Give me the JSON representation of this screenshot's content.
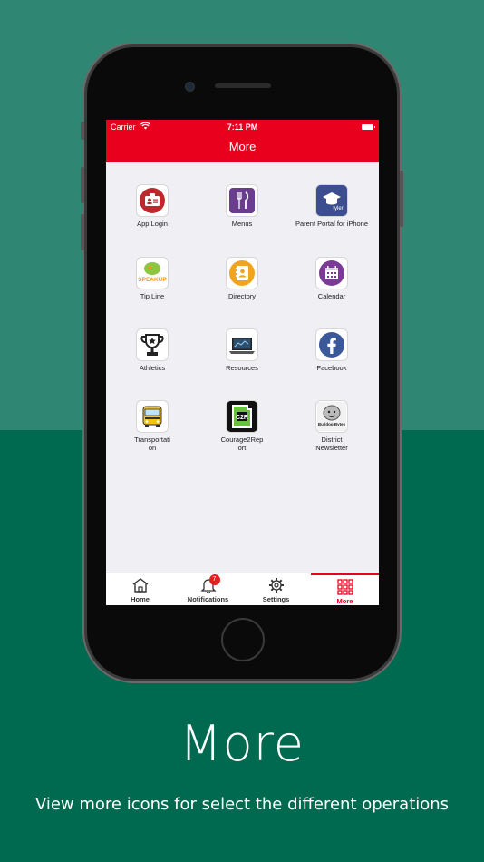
{
  "status_bar": {
    "carrier": "Carrier",
    "time": "7:11 PM"
  },
  "header": {
    "title": "More"
  },
  "tiles": [
    {
      "label": "App Login",
      "icon": "id-card-icon"
    },
    {
      "label": "Menus",
      "icon": "fork-knife-icon"
    },
    {
      "label": "Parent Portal for iPhone",
      "icon": "tyler-graduation-cap-icon",
      "badge_text": "tyler"
    },
    {
      "label": "Tip Line",
      "icon": "speak-up-logo-icon",
      "badge_text": "SPEAKUP"
    },
    {
      "label": "Directory",
      "icon": "address-book-icon"
    },
    {
      "label": "Calendar",
      "icon": "calendar-icon"
    },
    {
      "label": "Athletics",
      "icon": "trophy-icon"
    },
    {
      "label": "Resources",
      "icon": "laptop-icon"
    },
    {
      "label": "Facebook",
      "icon": "facebook-icon"
    },
    {
      "label": "Transportation",
      "icon": "school-bus-icon"
    },
    {
      "label": "Courage2Report",
      "icon": "c2r-logo-icon",
      "badge_text": "C2R"
    },
    {
      "label": "District Newsletter",
      "icon": "bulldog-bytes-icon",
      "badge_text": "Bulldog Bytes"
    }
  ],
  "tabbar": {
    "items": [
      {
        "label": "Home",
        "icon": "home-icon"
      },
      {
        "label": "Notifications",
        "icon": "bell-icon",
        "badge": "7"
      },
      {
        "label": "Settings",
        "icon": "gear-icon"
      },
      {
        "label": "More",
        "icon": "grid-icon"
      }
    ]
  },
  "caption": {
    "title": "More",
    "subtitle": "View more icons for select the different operations"
  },
  "colors": {
    "header_red": "#e8001c",
    "bg_top": "#2f8773",
    "bg_bottom": "#006a50",
    "screen_bg": "#efeff4"
  }
}
